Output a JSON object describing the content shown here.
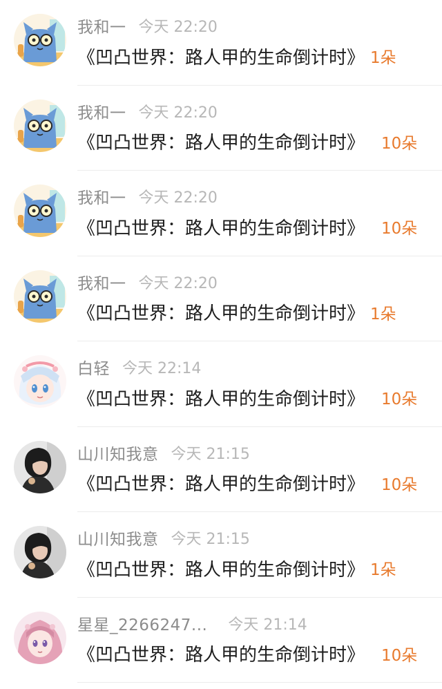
{
  "items": [
    {
      "username": "我和一",
      "time": "今天 22:20",
      "title": "《凹凸世界：路人甲的生命倒计时》",
      "count": "1朵",
      "avatar": "cat-avatar"
    },
    {
      "username": "我和一",
      "time": "今天 22:20",
      "title": "《凹凸世界：路人甲的生命倒计时》",
      "count": "10朵",
      "avatar": "cat-avatar"
    },
    {
      "username": "我和一",
      "time": "今天 22:20",
      "title": "《凹凸世界：路人甲的生命倒计时》",
      "count": "10朵",
      "avatar": "cat-avatar"
    },
    {
      "username": "我和一",
      "time": "今天 22:20",
      "title": "《凹凸世界：路人甲的生命倒计时》",
      "count": "1朵",
      "avatar": "cat-avatar"
    },
    {
      "username": "白轻",
      "time": "今天 22:14",
      "title": "《凹凸世界：路人甲的生命倒计时》",
      "count": "10朵",
      "avatar": "anime-girl-avatar"
    },
    {
      "username": "山川知我意",
      "time": "今天 21:15",
      "title": "《凹凸世界：路人甲的生命倒计时》",
      "count": "10朵",
      "avatar": "portrait-avatar"
    },
    {
      "username": "山川知我意",
      "time": "今天 21:15",
      "title": "《凹凸世界：路人甲的生命倒计时》",
      "count": "1朵",
      "avatar": "portrait-avatar"
    },
    {
      "username": "星星_2266247...",
      "time": "今天 21:14",
      "title": "《凹凸世界：路人甲的生命倒计时》",
      "count": "10朵",
      "avatar": "pink-hair-girl-avatar"
    }
  ],
  "colors": {
    "username": "#8c8c8c",
    "time": "#b7b7b7",
    "title": "#1e1e1e",
    "count": "#e87a2d",
    "divider": "#ececec"
  }
}
